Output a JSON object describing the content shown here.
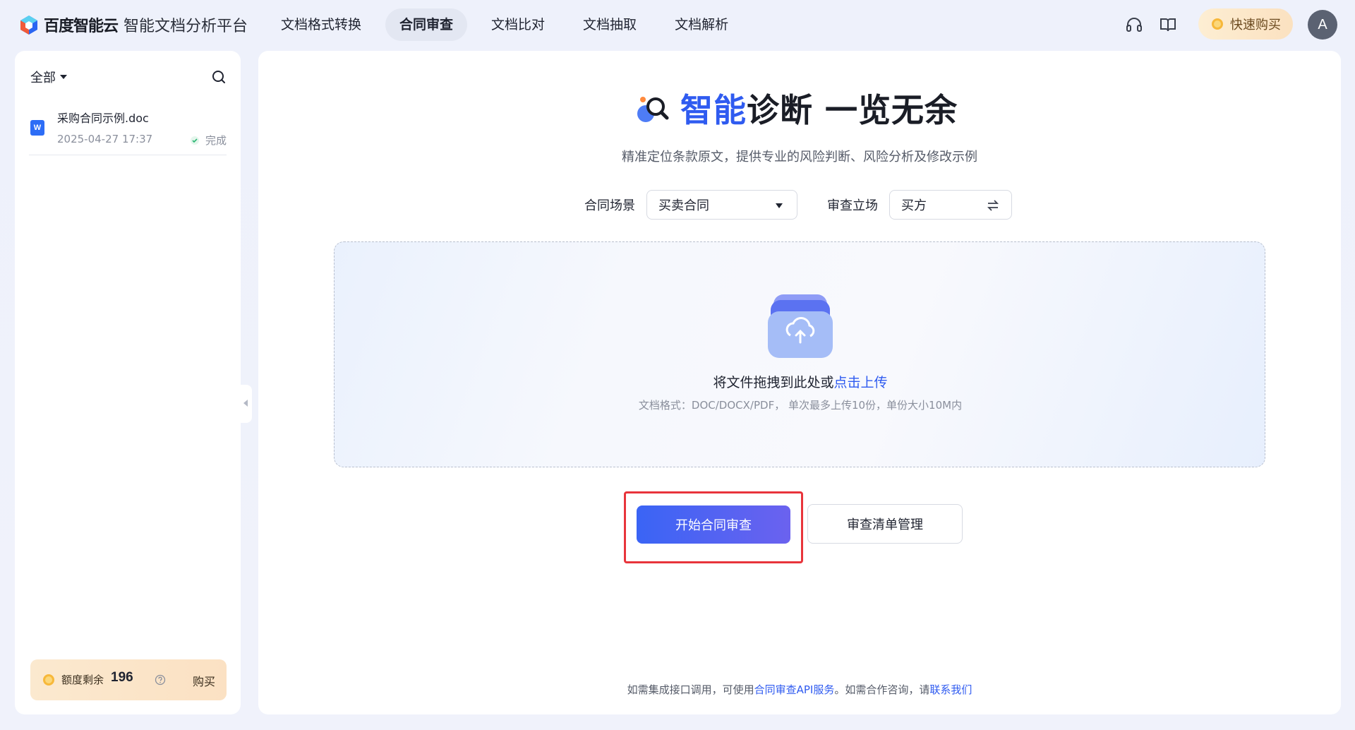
{
  "brand": {
    "name": "百度智能云",
    "product": "智能文档分析平台",
    "logo_icon": "baidu-cloud-logo-icon"
  },
  "nav": {
    "items": [
      {
        "label": "文档格式转换"
      },
      {
        "label": "合同审查",
        "active": true
      },
      {
        "label": "文档比对"
      },
      {
        "label": "文档抽取"
      },
      {
        "label": "文档解析"
      }
    ]
  },
  "topbar": {
    "headset_icon": "headset-icon",
    "book_icon": "book-icon",
    "buy_label": "快速购买",
    "avatar_letter": "A"
  },
  "sidebar": {
    "filter_label": "全部",
    "files": [
      {
        "name": "采购合同示例.doc",
        "time": "2025-04-27 17:37",
        "status": "完成",
        "type_badge": "W"
      }
    ],
    "quota": {
      "label": "额度剩余",
      "value": "196",
      "buy_label": "购买"
    }
  },
  "main": {
    "hero": {
      "title_accent": "智能",
      "title_rest": "诊断 一览无余",
      "subtitle": "精准定位条款原文，提供专业的风险判断、风险分析及修改示例"
    },
    "scene": {
      "label": "合同场景",
      "value": "买卖合同"
    },
    "stance": {
      "label": "审查立场",
      "value": "买方"
    },
    "upload": {
      "text_prefix": "将文件拖拽到此处或",
      "link": "点击上传",
      "hint": "文档格式：DOC/DOCX/PDF， 单次最多上传10份，单份大小10M内"
    },
    "primary_button": "开始合同审查",
    "secondary_button": "审查清单管理",
    "footer": {
      "prefix": "如需集成接口调用，可使用",
      "api_link": "合同审查API服务",
      "middle": "。如需合作咨询，请",
      "contact_link": "联系我们"
    }
  },
  "colors": {
    "accent": "#2f5bf0",
    "highlight_border": "#e8343b",
    "success": "#2bb673"
  }
}
